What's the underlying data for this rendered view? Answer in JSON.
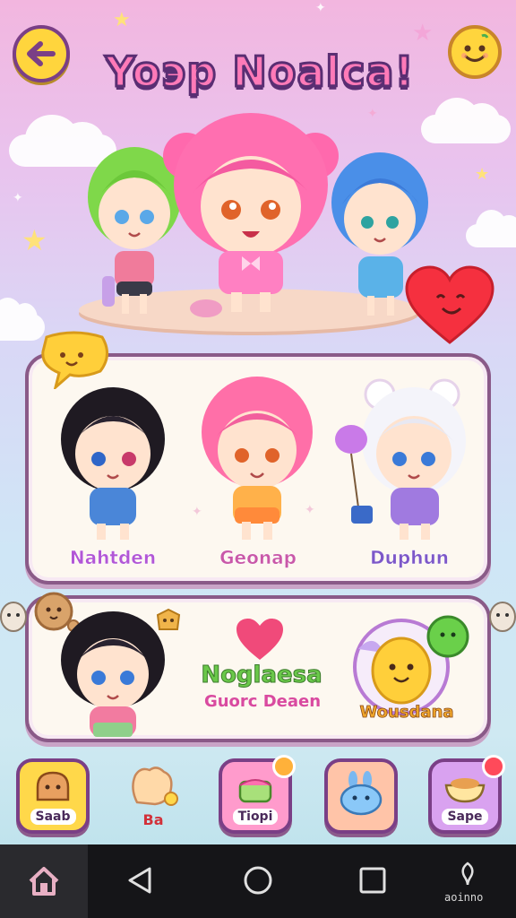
{
  "header": {
    "title": "Yoэp Noalca!",
    "back_icon": "back-arrow-icon",
    "profile_icon": "smiley-face-icon"
  },
  "featured": {
    "characters": [
      "green-hair-girl",
      "pink-hair-girl",
      "blue-hair-boy"
    ],
    "heart_icon": "heart-face-icon"
  },
  "roster": {
    "characters": [
      {
        "name": "Nahtden",
        "color": "#b257d6"
      },
      {
        "name": "Geonap",
        "color": "#c958a8"
      },
      {
        "name": "Duphun",
        "color": "#7d58c8"
      }
    ],
    "chat_icon": "speech-bubble-icon"
  },
  "feature_card": {
    "headline": "Noglaesa",
    "subline": "Guorc Deaen",
    "right_label": "Wousdana"
  },
  "toolbar": {
    "items": [
      {
        "label": "Saab",
        "icon": "bread-icon",
        "bg": "#ffd84a"
      },
      {
        "label": "Ba",
        "icon": "glove-icon",
        "bg": "transparent"
      },
      {
        "label": "Tiopi",
        "icon": "cake-icon",
        "bg": "#ff9bcc"
      },
      {
        "label": "",
        "icon": "bunny-icon",
        "bg": "#ffc4a8"
      },
      {
        "label": "Sape",
        "icon": "bowl-icon",
        "bg": "#d9a2f0"
      }
    ]
  },
  "system_nav": {
    "right_label": "aoinno"
  }
}
